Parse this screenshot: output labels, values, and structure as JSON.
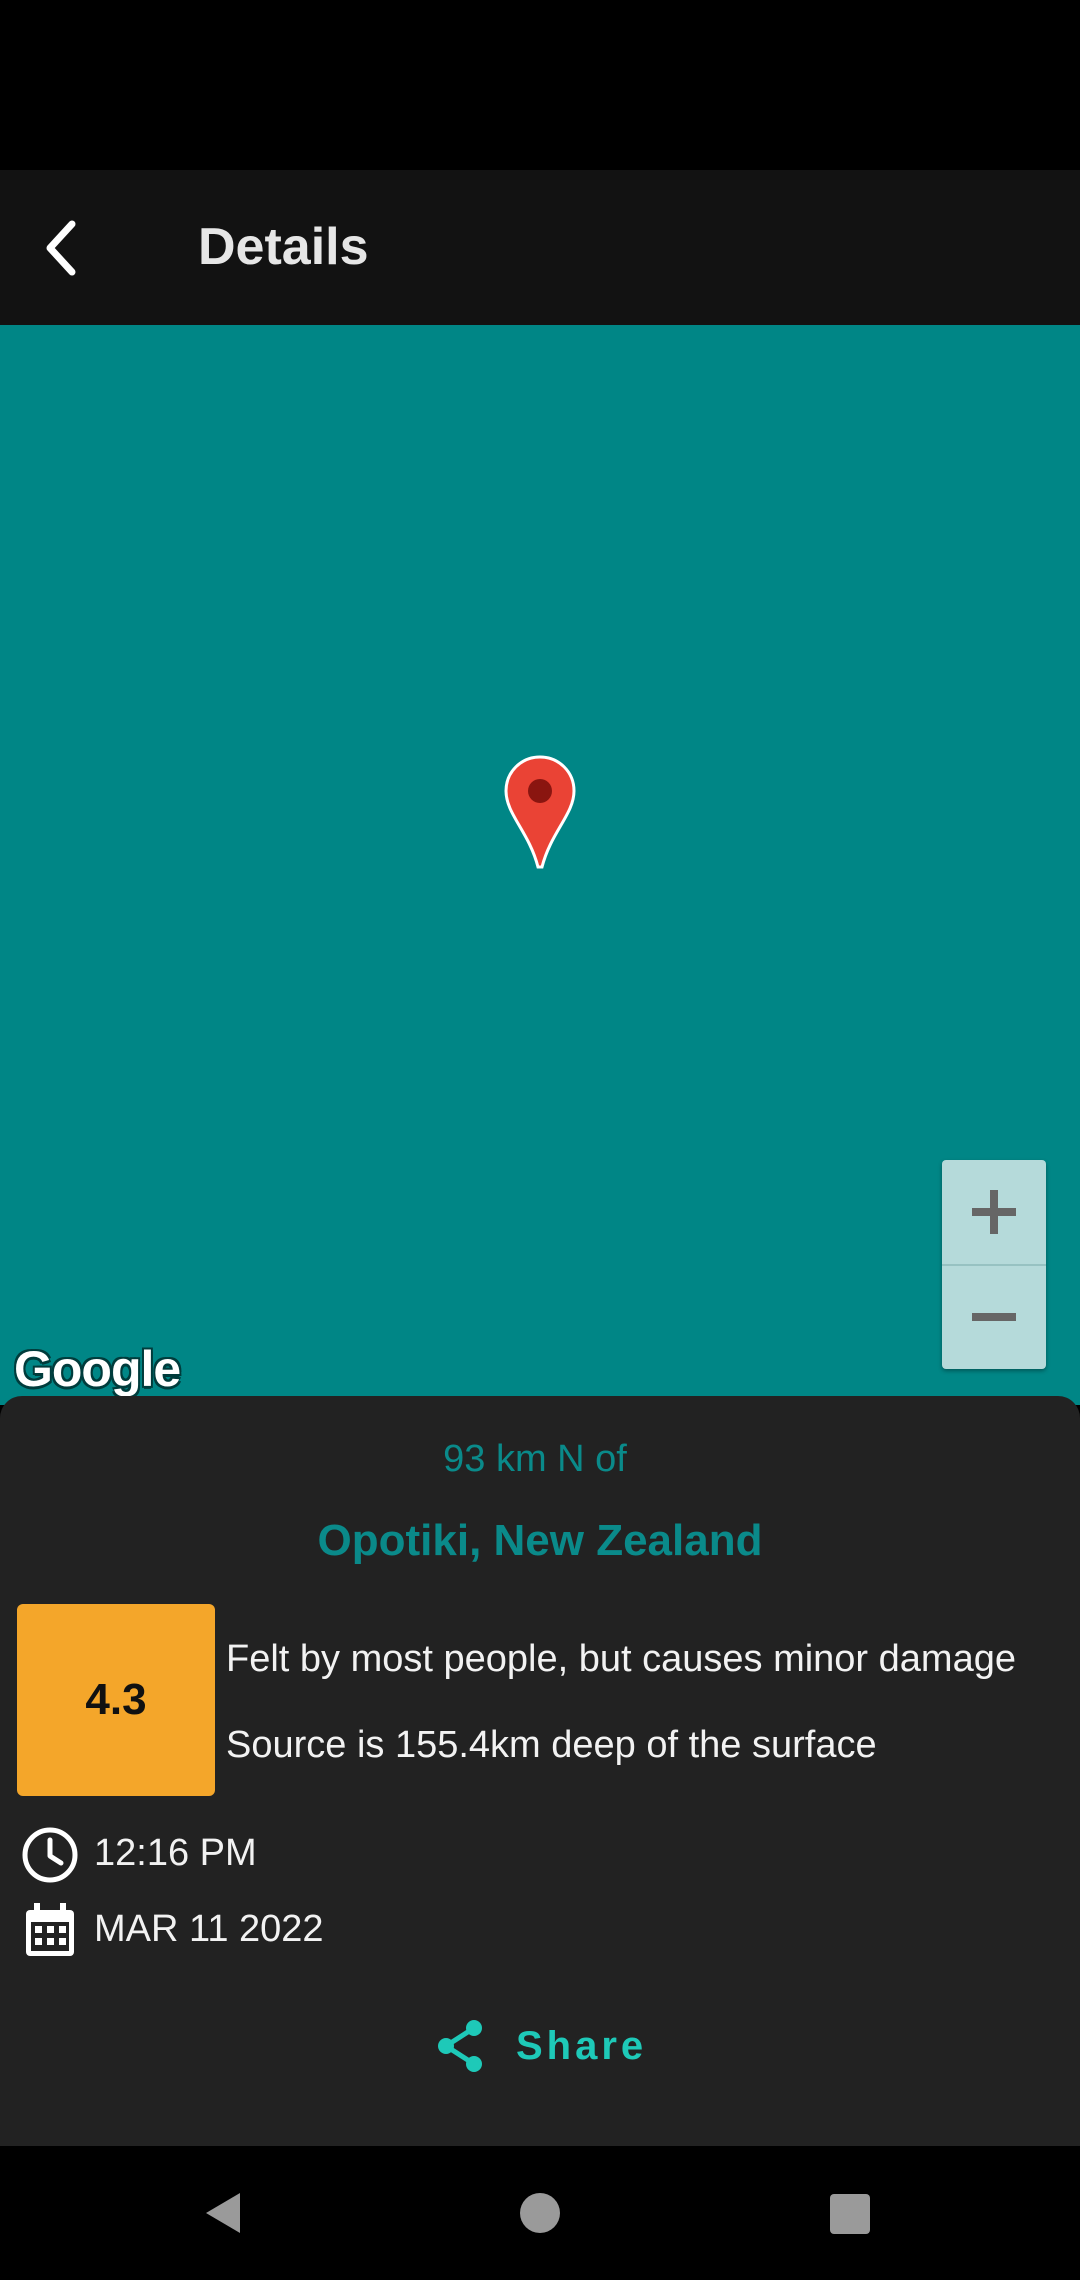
{
  "app_bar": {
    "title": "Details",
    "back_icon": "chevron-left-icon"
  },
  "map": {
    "background_color": "#008686",
    "attribution": "Google",
    "marker_icon": "map-pin-icon",
    "zoom_in_label": "+",
    "zoom_out_label": "−"
  },
  "details": {
    "distance": "93 km N of",
    "location": "Opotiki, New Zealand",
    "magnitude": "4.3",
    "magnitude_color": "#f4a62a",
    "felt_description": "Felt by most people, but causes minor damage",
    "depth_description": "Source is 155.4km deep of the surface",
    "time": "12:16 PM",
    "date": "MAR 11 2022",
    "share_label": "Share",
    "accent_color": "#1ec9b8"
  },
  "nav": {
    "back": "back-icon",
    "home": "home-icon",
    "recents": "recents-icon"
  }
}
